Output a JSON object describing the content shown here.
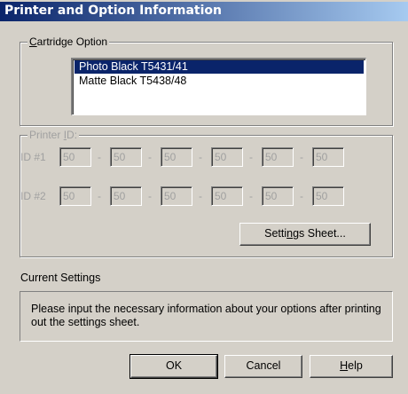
{
  "window": {
    "title": "Printer and Option Information"
  },
  "cartridge": {
    "legend_mnemonic": "C",
    "legend_rest": "artridge Option",
    "items": [
      {
        "label": "Photo Black T5431/41",
        "selected": true
      },
      {
        "label": "Matte Black T5438/48",
        "selected": false
      }
    ]
  },
  "printer_id": {
    "legend_prefix": "Printer ",
    "legend_mnemonic": "I",
    "legend_rest": "D:",
    "rows": [
      {
        "label": "ID #1",
        "values": [
          "50",
          "50",
          "50",
          "50",
          "50",
          "50"
        ]
      },
      {
        "label": "ID #2",
        "values": [
          "50",
          "50",
          "50",
          "50",
          "50",
          "50"
        ]
      }
    ],
    "separator": "-",
    "settings_sheet_prefix": "Setti",
    "settings_sheet_mnemonic": "n",
    "settings_sheet_rest": "gs Sheet..."
  },
  "current_settings": {
    "label": "Current Settings",
    "message": "Please input the necessary information about your options after printing out the settings sheet."
  },
  "buttons": {
    "ok": "OK",
    "cancel": "Cancel",
    "help_mnemonic": "H",
    "help_rest": "elp"
  },
  "colors": {
    "face": "#d4d0c8",
    "selection": "#0a246a",
    "disabled_text": "#a0a0a0"
  }
}
